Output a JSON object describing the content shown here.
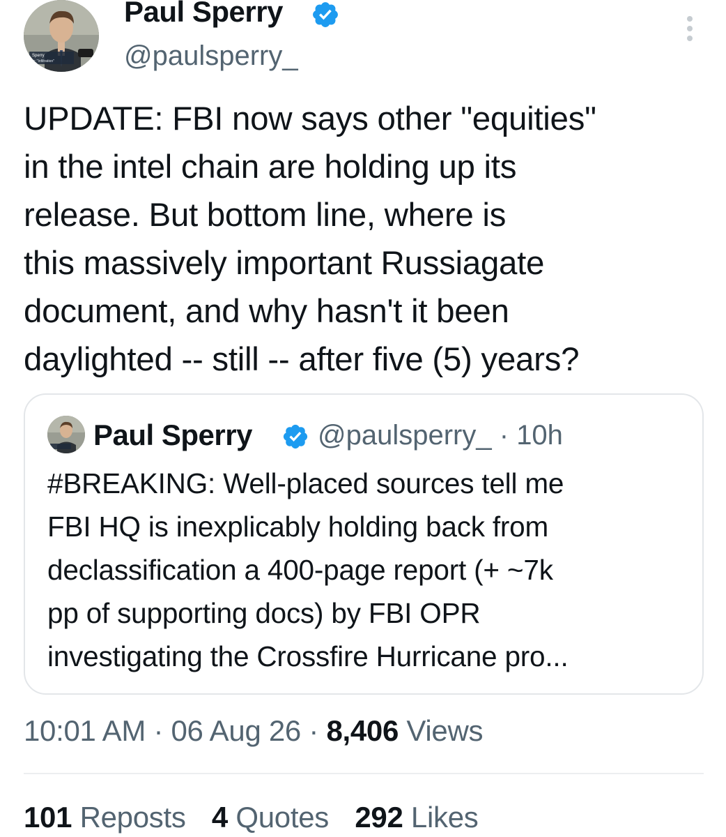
{
  "author": {
    "display_name": "Paul Sperry",
    "handle": "@paulsperry_",
    "verified_icon": "verified-badge-icon",
    "avatar_caption": [
      "Sperry",
      "ie: \"Infiltration\""
    ]
  },
  "tweet": {
    "text_lines": [
      "UPDATE: FBI now says other \"equities\"",
      "in the intel chain are holding up its",
      "release. But bottom line, where is",
      "this massively important Russiagate",
      "document, and why hasn't it been",
      "daylighted -- still -- after five (5) years?"
    ]
  },
  "quote": {
    "display_name": "Paul Sperry",
    "handle": "@paulsperry_",
    "separator": "·",
    "time_ago": "10h",
    "text_lines": [
      "#BREAKING: Well-placed sources tell me",
      "FBI HQ is inexplicably holding back from",
      "declassification a 400-page report (+ ~7k",
      "pp of supporting docs) by FBI OPR",
      "investigating the Crossfire Hurricane pro..."
    ]
  },
  "meta": {
    "time": "10:01 AM",
    "date": "06 Aug 26",
    "separator": "·",
    "views_count": "8,406",
    "views_label": "Views"
  },
  "stats": [
    {
      "count": "101",
      "label": "Reposts"
    },
    {
      "count": "4",
      "label": "Quotes"
    },
    {
      "count": "292",
      "label": "Likes"
    }
  ],
  "colors": {
    "verified": "#1d9bf0",
    "secondary_text": "#536471",
    "primary_text": "#0f1419"
  }
}
